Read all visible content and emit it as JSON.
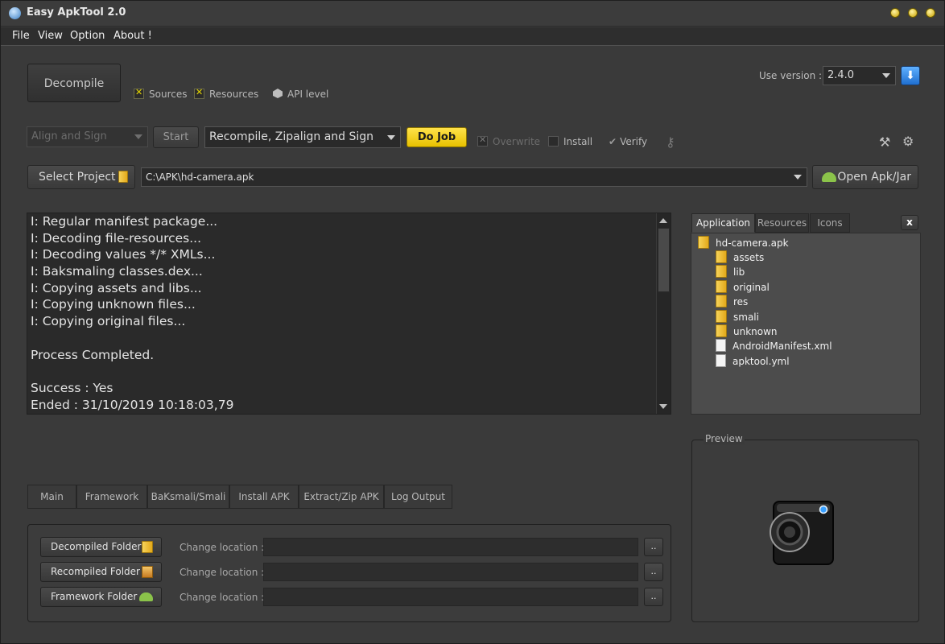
{
  "app": {
    "title": "Easy ApkTool 2.0"
  },
  "menu": [
    "File",
    "View",
    "Option",
    "About !"
  ],
  "decompile": {
    "button_label": "Decompile",
    "sources_label": "Sources",
    "resources_label": "Resources",
    "api_level_label": "API level"
  },
  "version": {
    "label": "Use version :",
    "value": "2.4.0"
  },
  "toolbar": {
    "align_sign_value": "Align and Sign",
    "start_label": "Start",
    "job_value": "Recompile, Zipalign and Sign",
    "do_job_label": "Do Job",
    "overwrite_label": "Overwrite",
    "install_label": "Install",
    "verify_label": "Verify"
  },
  "project": {
    "select_label": "Select Project",
    "path_value": "C:\\APK\\hd-camera.apk",
    "open_label": "Open Apk/Jar"
  },
  "log": {
    "lines": [
      "I: Regular manifest package...",
      "I: Decoding file-resources...",
      "I: Decoding values */* XMLs...",
      "I: Baksmaling classes.dex...",
      "I: Copying assets and libs...",
      "I: Copying unknown files...",
      "I: Copying original files...",
      "",
      "Process Completed.",
      "",
      "Success : Yes",
      "Ended : 31/10/2019 10:18:03,79"
    ]
  },
  "right_tabs": [
    "Application",
    "Resources",
    "Icons"
  ],
  "close_label": "x",
  "tree": {
    "root": "hd-camera.apk",
    "items": [
      {
        "label": "assets",
        "kind": "folder"
      },
      {
        "label": "lib",
        "kind": "folder"
      },
      {
        "label": "original",
        "kind": "folder"
      },
      {
        "label": "res",
        "kind": "folder"
      },
      {
        "label": "smali",
        "kind": "folder"
      },
      {
        "label": "unknown",
        "kind": "folder"
      },
      {
        "label": "AndroidManifest.xml",
        "kind": "file"
      },
      {
        "label": "apktool.yml",
        "kind": "file"
      }
    ]
  },
  "preview": {
    "label": "Preview"
  },
  "bottom_tabs": [
    "Main",
    "Framework",
    "BaKsmali/Smali",
    "Install APK",
    "Extract/Zip APK",
    "Log Output"
  ],
  "folders": [
    {
      "label": "Decompiled Folder",
      "change_label": "Change location :",
      "dots": ".."
    },
    {
      "label": "Recompiled Folder",
      "change_label": "Change location :",
      "dots": ".."
    },
    {
      "label": "Framework Folder",
      "change_label": "Change location :",
      "dots": ".."
    }
  ],
  "colors": {
    "accent": "#f2cf00",
    "panel": "#3a3a3a",
    "field": "#2a2a2a"
  }
}
